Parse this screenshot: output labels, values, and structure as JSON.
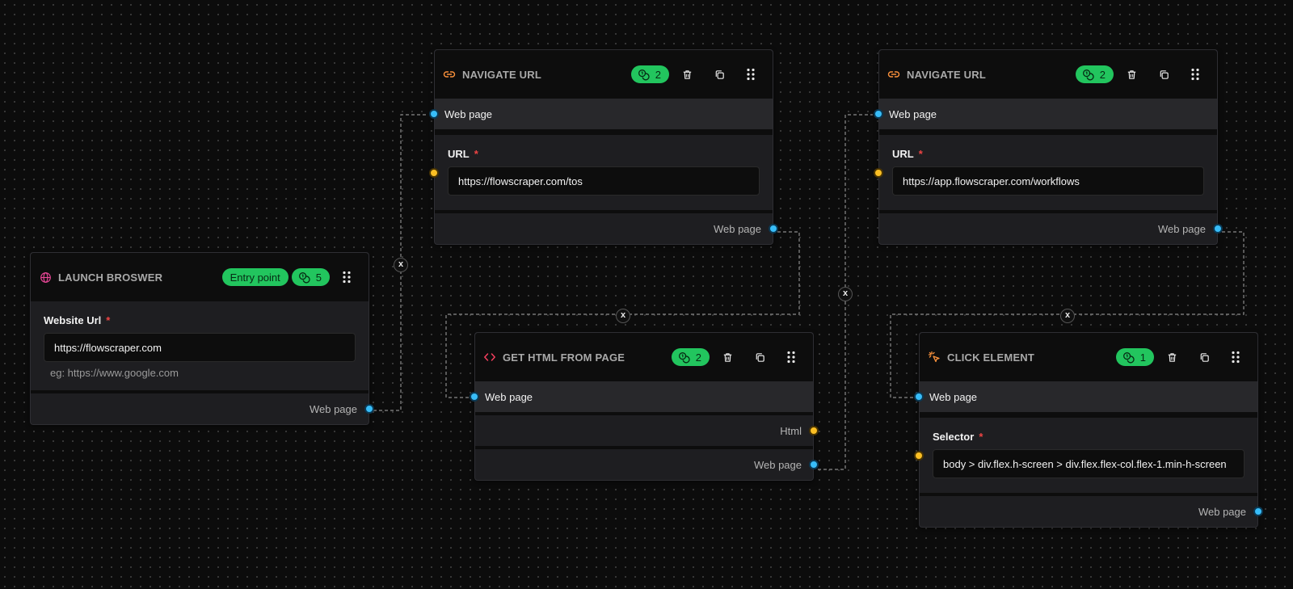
{
  "colors": {
    "canvas": "#0c0c0c",
    "node_bg": "#1e1e21",
    "header_bg": "#0d0d0d",
    "accent_green": "#22c55e",
    "handle_blue": "#38bdf8",
    "handle_yellow": "#fbbf24",
    "required": "#ef4444"
  },
  "nodes": {
    "launch": {
      "title": "LAUNCH BROSWER",
      "icon": "globe-icon",
      "entry_badge": "Entry point",
      "credits": "5",
      "field_label": "Website Url",
      "field_value": "https://flowscraper.com",
      "helper": "eg: https://www.google.com",
      "output": "Web page"
    },
    "nav1": {
      "title": "NAVIGATE URL",
      "icon": "link-icon",
      "credits": "2",
      "input_label": "Web page",
      "field_label": "URL",
      "field_value": "https://flowscraper.com/tos",
      "output": "Web page"
    },
    "nav2": {
      "title": "NAVIGATE URL",
      "icon": "link-icon",
      "credits": "2",
      "input_label": "Web page",
      "field_label": "URL",
      "field_value": "https://app.flowscraper.com/workflows",
      "output": "Web page"
    },
    "html": {
      "title": "GET HTML FROM PAGE",
      "icon": "code-icon",
      "credits": "2",
      "input_label": "Web page",
      "output_html": "Html",
      "output_web": "Web page"
    },
    "click": {
      "title": "CLICK ELEMENT",
      "icon": "pointer-click-icon",
      "credits": "1",
      "input_label": "Web page",
      "field_label": "Selector",
      "field_value": "body > div.flex.h-screen > div.flex.flex-col.flex-1.min-h-screen",
      "output": "Web page"
    }
  },
  "required_mark": "*",
  "edge_delete_label": "x"
}
